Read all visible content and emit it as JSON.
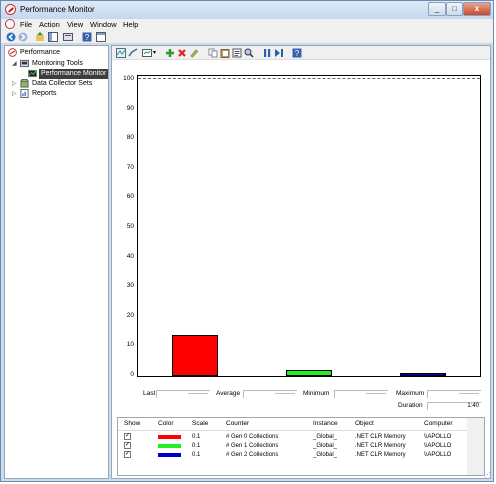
{
  "window": {
    "title": "Performance Monitor"
  },
  "menu": {
    "items": [
      "File",
      "Action",
      "View",
      "Window",
      "Help"
    ]
  },
  "tree": {
    "root": "Performance",
    "monitoring_tools": "Monitoring Tools",
    "performance_monitor": "Performance Monitor",
    "data_collector_sets": "Data Collector Sets",
    "reports": "Reports"
  },
  "chart_data": {
    "type": "bar",
    "categories": [
      "# Gen 0 Collections",
      "# Gen 1 Collections",
      "# Gen 2 Collections"
    ],
    "values": [
      14,
      2,
      1
    ],
    "colors": [
      "#ff0000",
      "#22ee22",
      "#0000cc"
    ],
    "ylim": [
      0,
      100
    ],
    "yticks": [
      "100",
      "90",
      "80",
      "70",
      "60",
      "50",
      "40",
      "30",
      "20",
      "10",
      "0"
    ]
  },
  "stats": {
    "last_label": "Last",
    "last_value": "----------",
    "average_label": "Average",
    "average_value": "----------",
    "minimum_label": "Minimum",
    "minimum_value": "----------",
    "maximum_label": "Maximum",
    "maximum_value": "----------",
    "duration_label": "Duration",
    "duration_value": "1:40"
  },
  "legend": {
    "headers": {
      "show": "Show",
      "color": "Color",
      "scale": "Scale",
      "counter": "Counter",
      "instance": "Instance",
      "object": "Object",
      "computer": "Computer"
    },
    "rows": [
      {
        "show": "✓",
        "color": "#ff0000",
        "scale": "0.1",
        "counter": "# Gen 0 Collections",
        "instance": "_Global_",
        "object": ".NET CLR Memory",
        "computer": "\\\\APOLLO"
      },
      {
        "show": "✓",
        "color": "#22ee22",
        "scale": "0.1",
        "counter": "# Gen 1 Collections",
        "instance": "_Global_",
        "object": ".NET CLR Memory",
        "computer": "\\\\APOLLO"
      },
      {
        "show": "✓",
        "color": "#0000cc",
        "scale": "0.1",
        "counter": "# Gen 2 Collections",
        "instance": "_Global_",
        "object": ".NET CLR Memory",
        "computer": "\\\\APOLLO"
      }
    ]
  },
  "icons": {
    "back": "back-arrow-icon",
    "forward": "forward-arrow-icon",
    "up": "up-folder-icon",
    "show_tree": "show-hide-tree-icon",
    "help": "help-icon",
    "properties": "properties-icon",
    "add": "add-counter-icon",
    "delete": "delete-counter-icon",
    "highlight": "highlight-icon",
    "copy": "copy-properties-icon",
    "paste": "paste-counter-list-icon",
    "zoom": "zoom-icon",
    "freeze": "freeze-display-icon",
    "update": "update-data-icon"
  }
}
